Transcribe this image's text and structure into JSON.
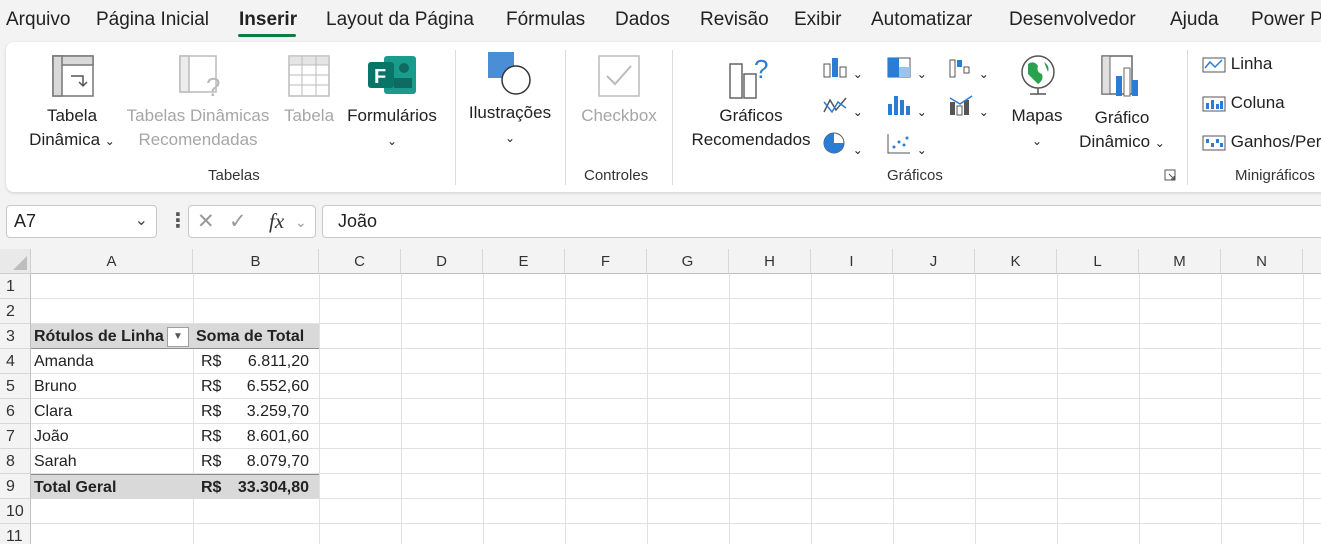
{
  "menu": {
    "items": [
      "Arquivo",
      "Página Inicial",
      "Inserir",
      "Layout da Página",
      "Fórmulas",
      "Dados",
      "Revisão",
      "Exibir",
      "Automatizar",
      "Desenvolvedor",
      "Ajuda",
      "Power P"
    ],
    "active": "Inserir"
  },
  "ribbon": {
    "tabela_dinamica": [
      "Tabela",
      "Dinâmica"
    ],
    "tabelas_recomendadas": [
      "Tabelas Dinâmicas",
      "Recomendadas"
    ],
    "tabela": "Tabela",
    "formularios": "Formulários",
    "grupo_tabelas": "Tabelas",
    "ilustracoes": "Ilustrações",
    "checkbox": "Checkbox",
    "grupo_controles": "Controles",
    "graficos_recomendados": [
      "Gráficos",
      "Recomendados"
    ],
    "mapas": "Mapas",
    "grafico_dinamico": [
      "Gráfico",
      "Dinâmico"
    ],
    "grupo_graficos": "Gráficos",
    "linha": "Linha",
    "coluna": "Coluna",
    "ganhos": "Ganhos/Per",
    "grupo_minigraficos": "Minigráficos"
  },
  "formula_bar": {
    "name_box": "A7",
    "fx": "fx",
    "content": "João"
  },
  "columns": [
    "A",
    "B",
    "C",
    "D",
    "E",
    "F",
    "G",
    "H",
    "I",
    "J",
    "K",
    "L",
    "M",
    "N"
  ],
  "rows": [
    "1",
    "2",
    "3",
    "4",
    "5",
    "6",
    "7",
    "8",
    "9",
    "10",
    "11"
  ],
  "pivot": {
    "header_row": "Rótulos de Linha",
    "header_value": "Soma de Total",
    "currency": "R$",
    "rows": [
      {
        "name": "Amanda",
        "value": "6.811,20"
      },
      {
        "name": "Bruno",
        "value": "6.552,60"
      },
      {
        "name": "Clara",
        "value": "3.259,70"
      },
      {
        "name": "João",
        "value": "8.601,60"
      },
      {
        "name": "Sarah",
        "value": "8.079,70"
      }
    ],
    "total_label": "Total Geral",
    "total_value": "33.304,80"
  }
}
